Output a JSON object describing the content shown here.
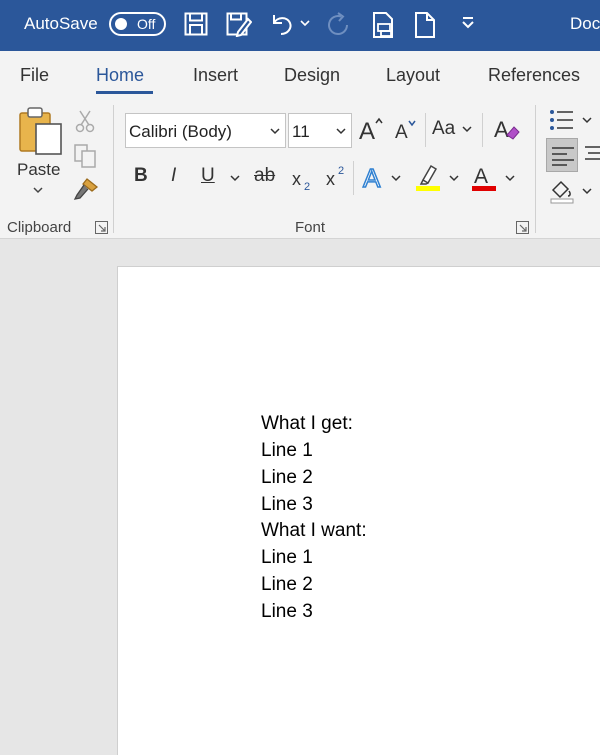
{
  "titlebar": {
    "autosave_label": "AutoSave",
    "autosave_state": "Off",
    "doc_title": "Doc"
  },
  "tabs": [
    "File",
    "Home",
    "Insert",
    "Design",
    "Layout",
    "References"
  ],
  "ribbon": {
    "clipboard": {
      "paste_label": "Paste",
      "group_label": "Clipboard"
    },
    "font": {
      "font_name": "Calibri (Body)",
      "font_size": "11",
      "change_case": "Aa",
      "bold": "B",
      "italic": "I",
      "underline": "U",
      "strikethrough": "ab",
      "group_label": "Font"
    }
  },
  "document": {
    "lines": [
      "What I get:",
      "Line 1",
      "Line 2",
      "Line 3",
      "What I want:",
      "Line 1",
      "Line 2",
      "Line 3"
    ]
  },
  "colors": {
    "title_bar": "#2b579a",
    "highlight": "#ffff00",
    "font_color": "#e00000",
    "text_effects": "#2f80d1"
  }
}
